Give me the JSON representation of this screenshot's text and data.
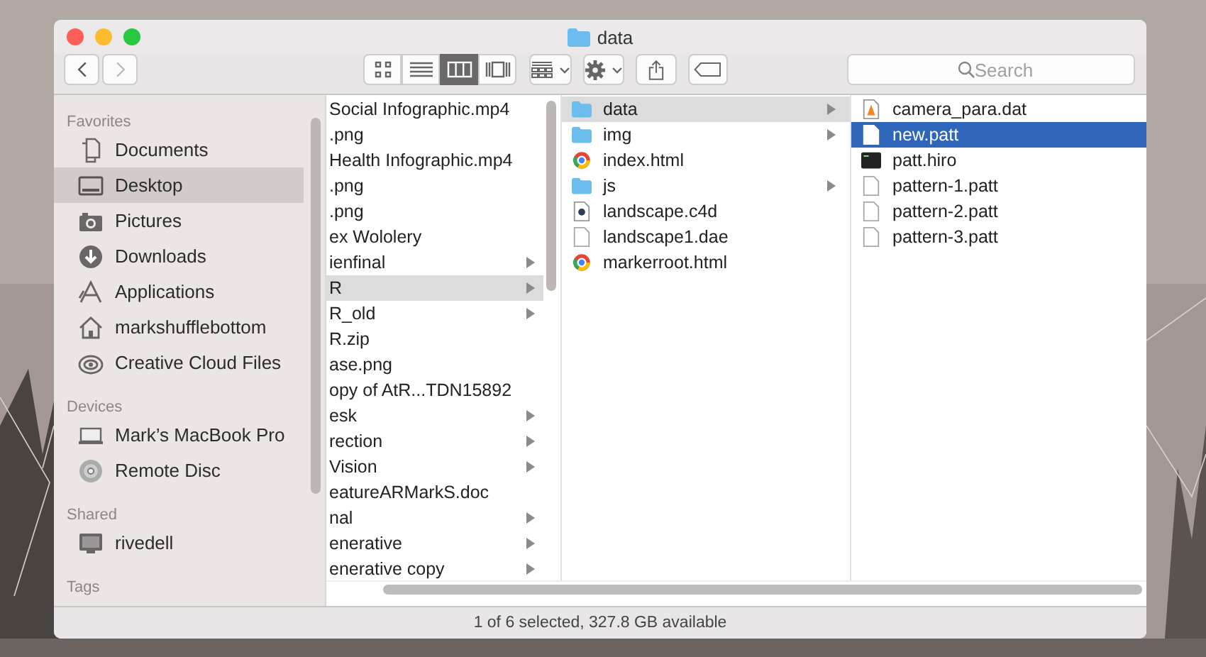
{
  "window": {
    "title": "data"
  },
  "toolbar": {
    "view_modes": [
      {
        "kind": "icons",
        "selected": false
      },
      {
        "kind": "list",
        "selected": false
      },
      {
        "kind": "columns",
        "selected": true
      },
      {
        "kind": "gallery",
        "selected": false
      }
    ],
    "search": {
      "placeholder": "Search"
    }
  },
  "sidebar": {
    "sections": [
      {
        "title": "Favorites",
        "items": [
          {
            "label": "Documents",
            "kind": "documents",
            "selected": false
          },
          {
            "label": "Desktop",
            "kind": "desktop",
            "selected": true
          },
          {
            "label": "Pictures",
            "kind": "camera",
            "selected": false
          },
          {
            "label": "Downloads",
            "kind": "download",
            "selected": false
          },
          {
            "label": "Applications",
            "kind": "apps",
            "selected": false
          },
          {
            "label": "markshufflebottom",
            "kind": "home",
            "selected": false
          },
          {
            "label": "Creative Cloud Files",
            "kind": "cloud",
            "selected": false
          }
        ]
      },
      {
        "title": "Devices",
        "items": [
          {
            "label": "Mark’s MacBook Pro",
            "kind": "laptop",
            "selected": false
          },
          {
            "label": "Remote Disc",
            "kind": "disc",
            "selected": false
          }
        ]
      },
      {
        "title": "Shared",
        "items": [
          {
            "label": "rivedell",
            "kind": "monitor",
            "selected": false
          }
        ]
      },
      {
        "title": "Tags"
      }
    ]
  },
  "columns": [
    {
      "focused": false,
      "rows": [
        {
          "name": "Social Infographic.mp4",
          "has_children": false,
          "selected": false
        },
        {
          "name": ".png",
          "has_children": false,
          "selected": false
        },
        {
          "name": "Health Infographic.mp4",
          "has_children": false,
          "selected": false
        },
        {
          "name": ".png",
          "has_children": false,
          "selected": false
        },
        {
          "name": ".png",
          "has_children": false,
          "selected": false
        },
        {
          "name": "ex Wololery",
          "has_children": false,
          "selected": false
        },
        {
          "name": "ienfinal",
          "has_children": true,
          "selected": false
        },
        {
          "name": "R",
          "has_children": true,
          "selected": true
        },
        {
          "name": "R_old",
          "has_children": true,
          "selected": false
        },
        {
          "name": "R.zip",
          "has_children": false,
          "selected": false
        },
        {
          "name": "ase.png",
          "has_children": false,
          "selected": false
        },
        {
          "name": "opy of AtR...TDN15892",
          "has_children": false,
          "selected": false
        },
        {
          "name": "esk",
          "has_children": true,
          "selected": false
        },
        {
          "name": "rection",
          "has_children": true,
          "selected": false
        },
        {
          "name": "Vision",
          "has_children": true,
          "selected": false
        },
        {
          "name": "eatureARMarkS.doc",
          "has_children": false,
          "selected": false
        },
        {
          "name": "nal",
          "has_children": true,
          "selected": false
        },
        {
          "name": "enerative",
          "has_children": true,
          "selected": false
        },
        {
          "name": "enerative copy",
          "has_children": true,
          "selected": false
        }
      ]
    },
    {
      "focused": false,
      "rows": [
        {
          "name": "data",
          "kind": "folder",
          "has_children": true,
          "selected": true
        },
        {
          "name": "img",
          "kind": "folder",
          "has_children": true,
          "selected": false
        },
        {
          "name": "index.html",
          "kind": "web",
          "has_children": false,
          "selected": false
        },
        {
          "name": "js",
          "kind": "folder",
          "has_children": true,
          "selected": false
        },
        {
          "name": "landscape.c4d",
          "kind": "model",
          "has_children": false,
          "selected": false
        },
        {
          "name": "landscape1.dae",
          "kind": "document",
          "has_children": false,
          "selected": false
        },
        {
          "name": "markerroot.html",
          "kind": "web",
          "has_children": false,
          "selected": false
        }
      ]
    },
    {
      "focused": true,
      "rows": [
        {
          "name": "camera_para.dat",
          "kind": "cone",
          "has_children": false,
          "selected": false
        },
        {
          "name": "new.patt",
          "kind": "document",
          "has_children": false,
          "selected": true
        },
        {
          "name": "patt.hiro",
          "kind": "terminal",
          "has_children": false,
          "selected": false
        },
        {
          "name": "pattern-1.patt",
          "kind": "document",
          "has_children": false,
          "selected": false
        },
        {
          "name": "pattern-2.patt",
          "kind": "document",
          "has_children": false,
          "selected": false
        },
        {
          "name": "pattern-3.patt",
          "kind": "document",
          "has_children": false,
          "selected": false
        }
      ]
    }
  ],
  "status_bar": "1 of 6 selected, 327.8 GB available"
}
